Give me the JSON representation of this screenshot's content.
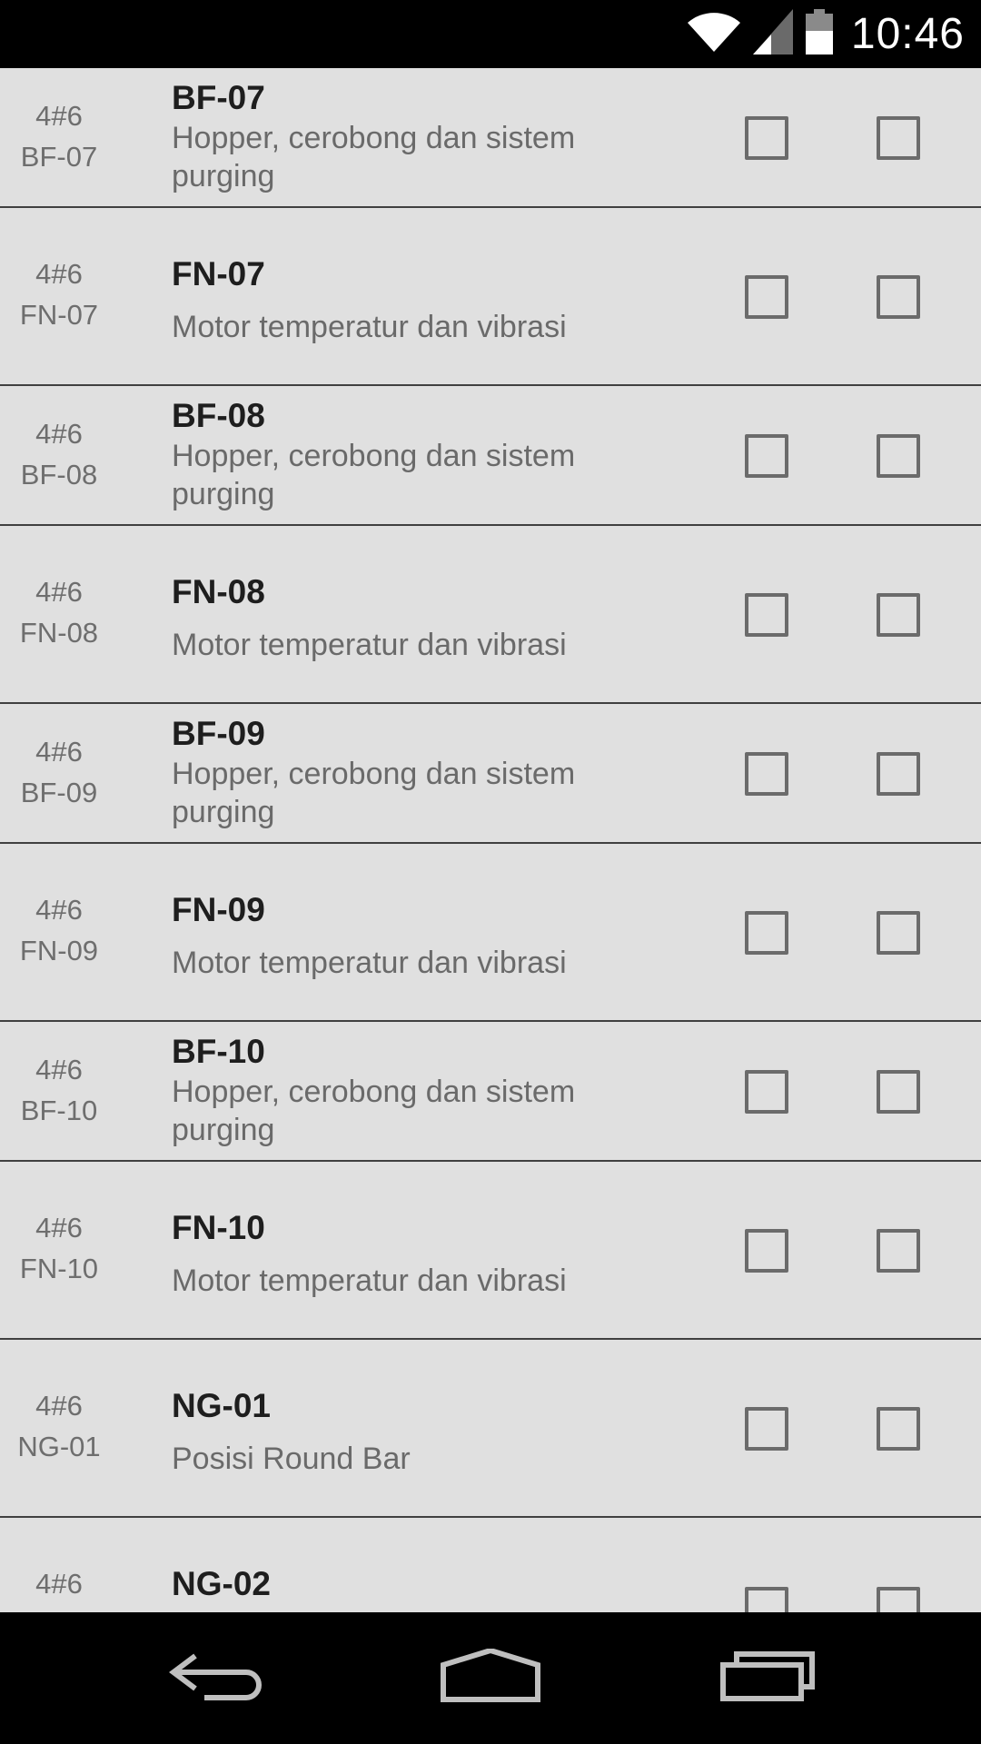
{
  "status_bar": {
    "time": "10:46",
    "icons": [
      "wifi-icon",
      "cell-signal-icon",
      "battery-icon"
    ]
  },
  "rows": [
    {
      "unit": "4#6",
      "code": "BF-07",
      "title": "BF-07",
      "desc": "Hopper, cerobong dan sistem purging"
    },
    {
      "unit": "4#6",
      "code": "FN-07",
      "title": "FN-07",
      "desc": "Motor temperatur dan vibrasi"
    },
    {
      "unit": "4#6",
      "code": "BF-08",
      "title": "BF-08",
      "desc": "Hopper, cerobong dan sistem purging"
    },
    {
      "unit": "4#6",
      "code": "FN-08",
      "title": "FN-08",
      "desc": "Motor temperatur dan vibrasi"
    },
    {
      "unit": "4#6",
      "code": "BF-09",
      "title": "BF-09",
      "desc": "Hopper, cerobong dan sistem purging"
    },
    {
      "unit": "4#6",
      "code": "FN-09",
      "title": "FN-09",
      "desc": "Motor temperatur dan vibrasi"
    },
    {
      "unit": "4#6",
      "code": "BF-10",
      "title": "BF-10",
      "desc": "Hopper, cerobong dan sistem purging"
    },
    {
      "unit": "4#6",
      "code": "FN-10",
      "title": "FN-10",
      "desc": "Motor temperatur dan vibrasi"
    },
    {
      "unit": "4#6",
      "code": "NG-01",
      "title": "NG-01",
      "desc": "Posisi Round Bar"
    },
    {
      "unit": "4#6",
      "code": "",
      "title": "NG-02",
      "desc": ""
    }
  ],
  "nav_bar": {
    "icons": [
      "back-icon",
      "home-icon",
      "recent-apps-icon"
    ]
  }
}
